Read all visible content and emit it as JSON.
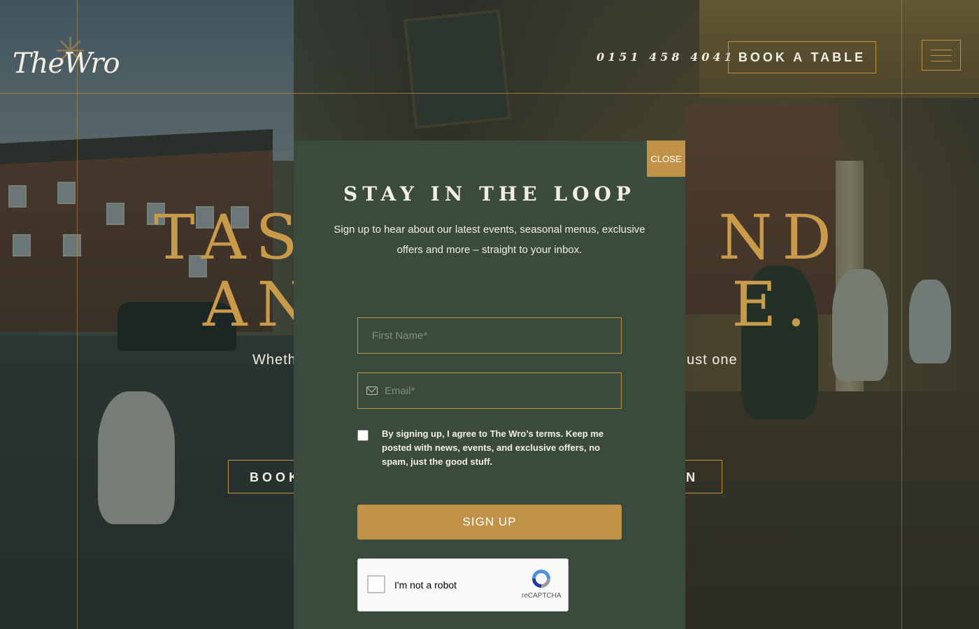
{
  "header": {
    "logo_text": "TheWro",
    "phone": "0151 458 4041",
    "book_label": "BOOK A TABLE"
  },
  "hero": {
    "headline_line1": "TAS              ND",
    "headline_line2": "AN              E.",
    "subtitle_left": "Wheth",
    "subtitle_right": "ust one",
    "button_left": "BOOK",
    "button_right": "N"
  },
  "modal": {
    "close_label": "CLOSE",
    "title": "STAY IN THE LOOP",
    "description": "Sign up to hear about our latest events, seasonal menus, exclusive offers and more – straight to your inbox.",
    "first_name_placeholder": "First Name*",
    "email_placeholder": "Email*",
    "consent_text": "By signing up, I agree to The Wro’s terms. Keep me posted with news, events, and exclusive offers, no spam, just the good stuff.",
    "signup_label": "SIGN UP",
    "captcha_label": "I'm not a robot",
    "captcha_brand": "reCAPTCHA"
  },
  "colors": {
    "accent": "#bf9248",
    "modal_bg": "#3a4a3d",
    "text_light": "#f3efe4"
  }
}
